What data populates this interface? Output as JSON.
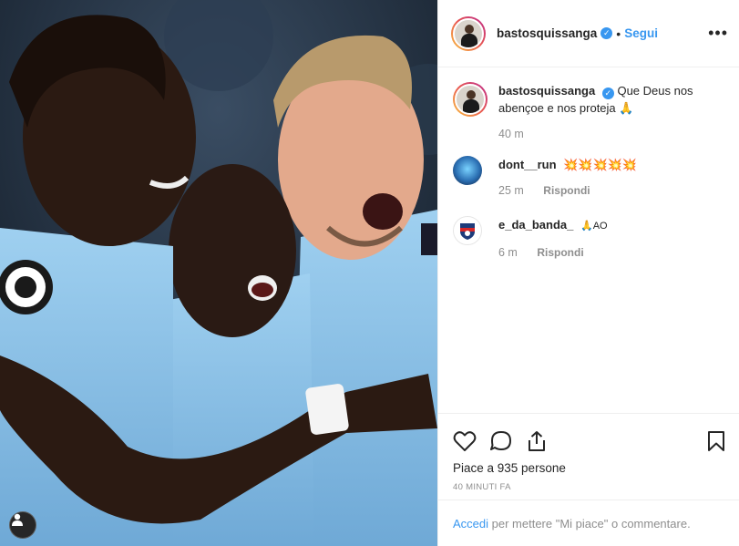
{
  "post": {
    "username": "bastosquissanga",
    "follow_label": "Segui",
    "dot": "•",
    "more_label": "•••"
  },
  "caption": {
    "username": "bastosquissanga",
    "text": "Que Deus nos abençoe e nos proteja 🙏",
    "time": "40 m"
  },
  "comments": [
    {
      "username": "dont__run",
      "text": "💥💥💥💥💥",
      "time": "25 m",
      "reply_label": "Rispondi"
    },
    {
      "username": "e_da_banda_",
      "text": "🙏AO",
      "time": "6 m",
      "reply_label": "Rispondi"
    }
  ],
  "actions": {
    "likes_text": "Piace a 935 persone",
    "timestamp": "40 minuti fa"
  },
  "login": {
    "link_label": "Accedi",
    "rest_text": " per mettere \"Mi piace\" o commentare."
  },
  "colors": {
    "accent": "#3897f0",
    "text": "#262626",
    "muted": "#8e8e8e",
    "jersey": "#8ec5ea"
  }
}
